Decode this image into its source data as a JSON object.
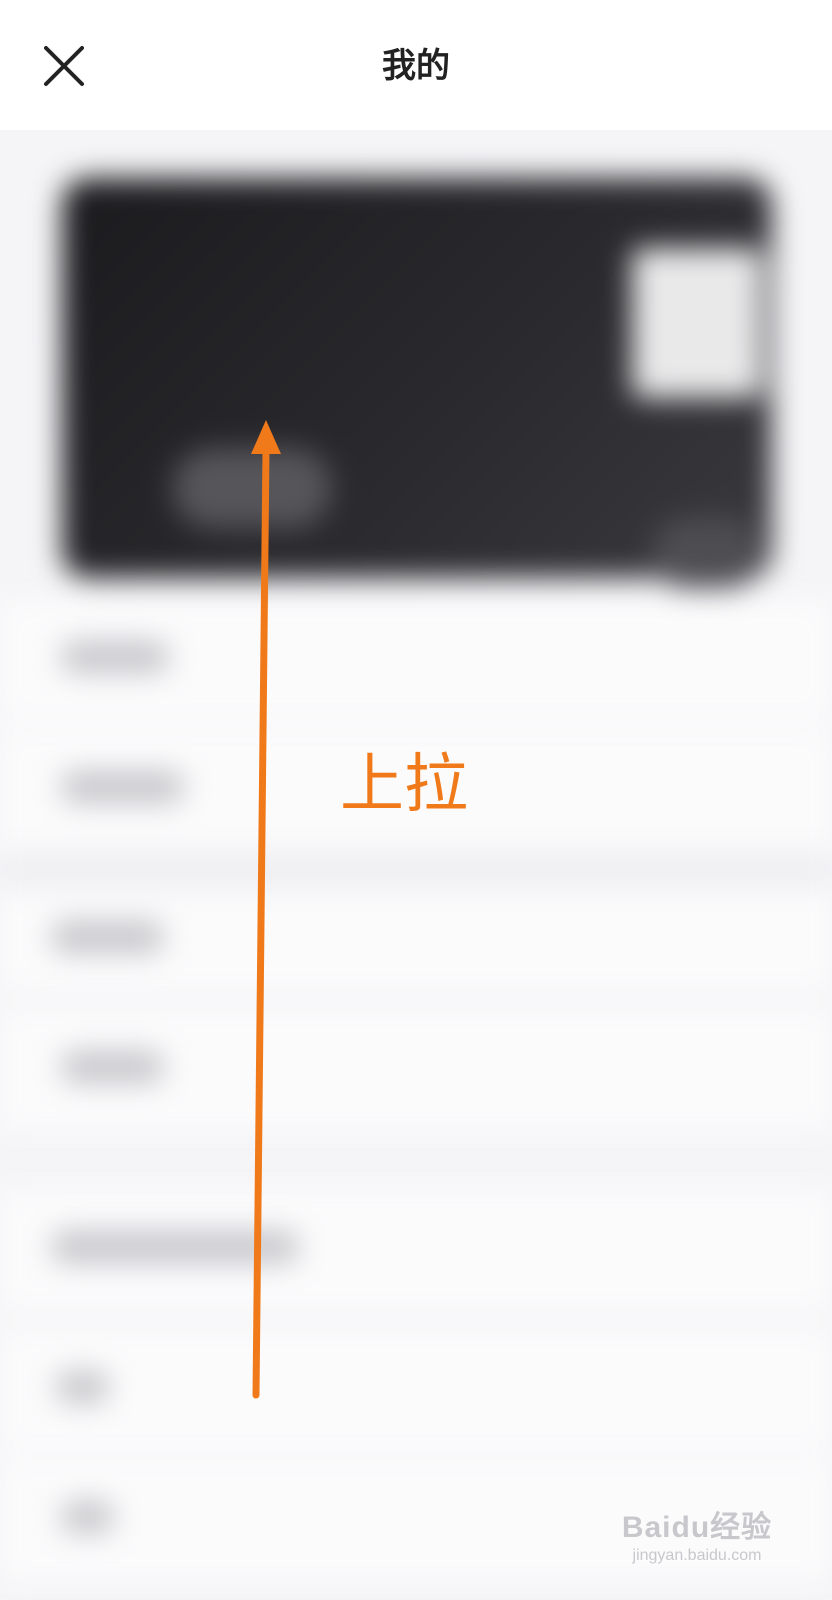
{
  "header": {
    "title": "我的",
    "close_icon": "close-icon"
  },
  "annotation": {
    "label": "上拉",
    "arrow_color": "#f07a1a",
    "arrow_direction": "up"
  },
  "watermark": {
    "brand": "Baidu经验",
    "url": "jingyan.baidu.com"
  },
  "colors": {
    "header_background": "#ffffff",
    "content_background": "#f5f5f7",
    "card_dark": "#1f1f22",
    "accent_orange": "#f07a1a"
  }
}
